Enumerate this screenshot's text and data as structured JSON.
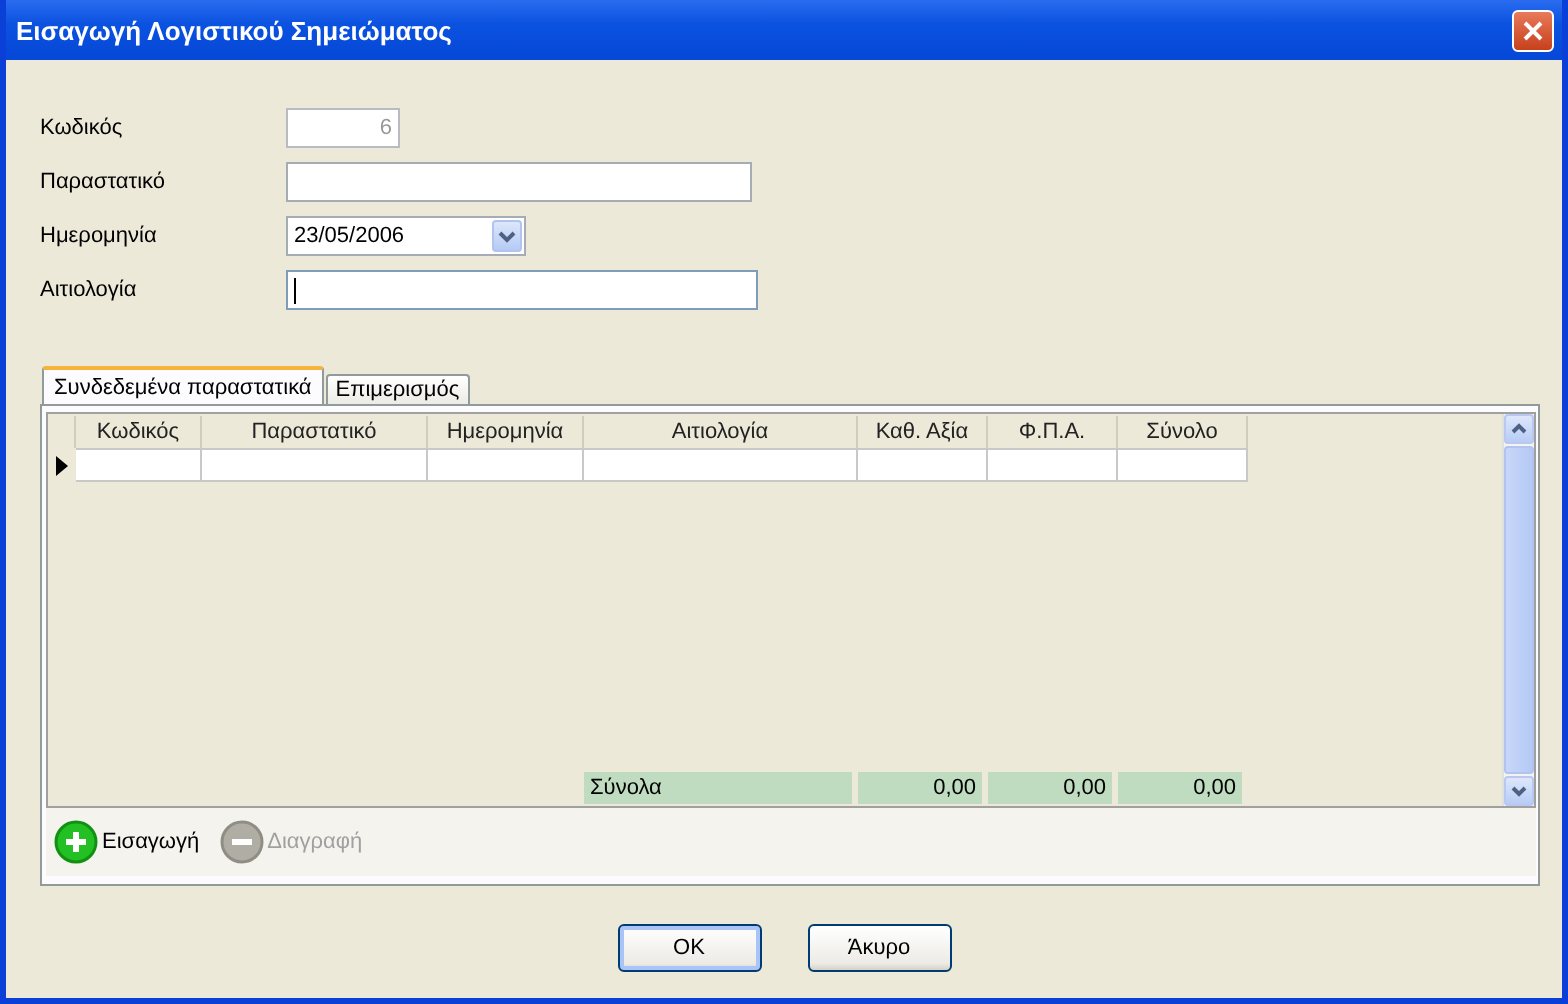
{
  "window": {
    "title": "Εισαγωγή Λογιστικού Σημειώματος"
  },
  "fields": [
    {
      "label": "Κωδικός",
      "kind": "number",
      "value": "6",
      "disabled": true,
      "focused": false
    },
    {
      "label": "Παραστατικό",
      "kind": "text",
      "disabled": false,
      "focused": false
    },
    {
      "label": "Ημερομηνία",
      "kind": "date",
      "value": "23/05/2006",
      "disabled": false,
      "focused": false
    },
    {
      "label": "Αιτιολογία",
      "kind": "text",
      "disabled": false,
      "focused": true
    }
  ],
  "tabs": [
    {
      "label": "Συνδεδεμένα παραστατικά",
      "selected": true
    },
    {
      "label": "Επιμερισμός",
      "selected": false
    }
  ],
  "table": {
    "columns": [
      "Κωδικός",
      "Παραστατικό",
      "Ημερομηνία",
      "Αιτιολογία",
      "Καθ. Αξία",
      "Φ.Π.Α.",
      "Σύνολο"
    ],
    "rows": [
      {
        "current": true
      }
    ],
    "totals": {
      "label": "Σύνολα",
      "values": [
        "0,00",
        "0,00",
        "0,00"
      ]
    }
  },
  "actions": [
    {
      "label": "Εισαγωγή",
      "kind": "add",
      "disabled": false
    },
    {
      "label": "Διαγραφή",
      "kind": "remove",
      "disabled": true
    }
  ],
  "buttons": [
    "OK",
    "Άκυρο"
  ]
}
